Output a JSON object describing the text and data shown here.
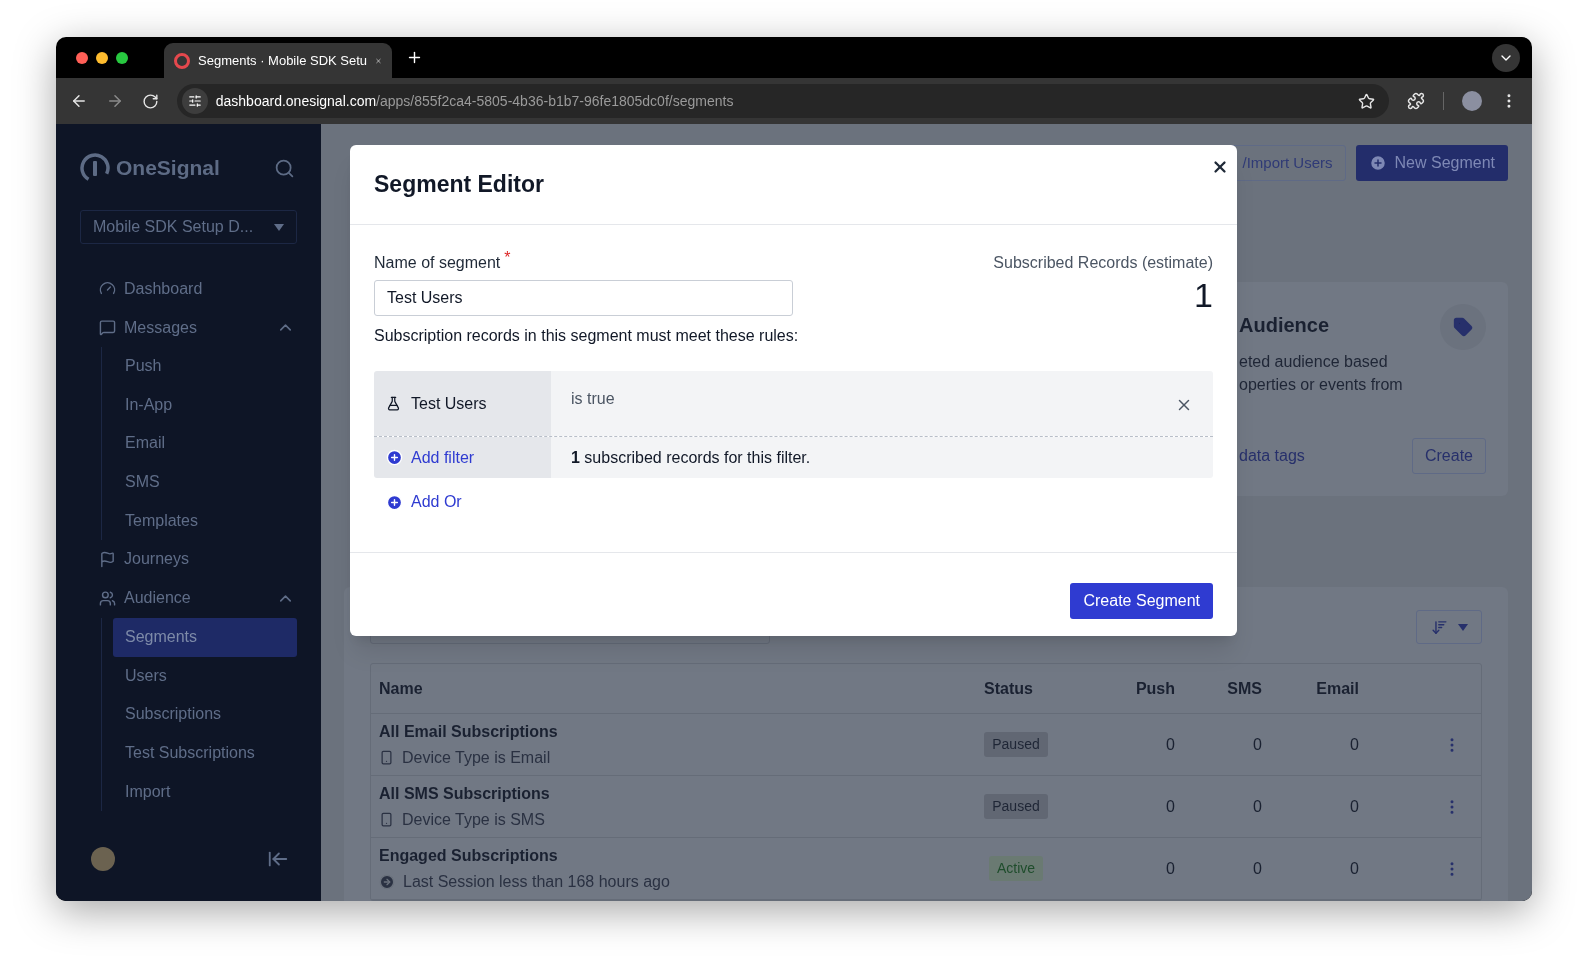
{
  "browser": {
    "tab": {
      "title": "Segments · Mobile SDK Setu"
    },
    "url": {
      "host": "dashboard.onesignal.com",
      "path": "/apps/855f2ca4-5805-4b36-b1b7-96fe1805dc0f/segments"
    }
  },
  "sidebar": {
    "brand": "OneSignal",
    "app_selector": "Mobile SDK Setup D...",
    "nav": [
      {
        "label": "Dashboard",
        "selected": false
      },
      {
        "label": "Messages",
        "selected": false,
        "expanded": true,
        "children": [
          {
            "label": "Push",
            "selected": false
          },
          {
            "label": "In-App",
            "selected": false
          },
          {
            "label": "Email",
            "selected": false
          },
          {
            "label": "SMS",
            "selected": false
          },
          {
            "label": "Templates",
            "selected": false
          }
        ]
      },
      {
        "label": "Journeys",
        "selected": false
      },
      {
        "label": "Audience",
        "selected": false,
        "expanded": true,
        "children": [
          {
            "label": "Segments",
            "selected": true
          },
          {
            "label": "Users",
            "selected": false
          },
          {
            "label": "Subscriptions",
            "selected": false
          },
          {
            "label": "Test Subscriptions",
            "selected": false
          },
          {
            "label": "Import",
            "selected": false
          }
        ]
      }
    ]
  },
  "header_buttons": [
    {
      "label": "/Import Users",
      "kind": "outline"
    },
    {
      "label": "New Segment",
      "kind": "primary"
    }
  ],
  "audience_card": {
    "title": "Audience",
    "lines": [
      "eted audience based",
      "operties or events from"
    ],
    "link": "data tags",
    "button": "Create"
  },
  "table": {
    "columns": [
      "Name",
      "Status",
      "Push",
      "SMS",
      "Email"
    ],
    "rows": [
      {
        "name": "All Email Subscriptions",
        "rule": {
          "text": "Device Type is Email",
          "kind": "device"
        },
        "status": {
          "label": "Paused",
          "kind": "paused"
        },
        "push": "0",
        "sms": "0",
        "email": "0"
      },
      {
        "name": "All SMS Subscriptions",
        "rule": {
          "text": "Device Type is SMS",
          "kind": "device"
        },
        "status": {
          "label": "Paused",
          "kind": "paused"
        },
        "push": "0",
        "sms": "0",
        "email": "0"
      },
      {
        "name": "Engaged Subscriptions",
        "rule": {
          "text": "Last Session less than 168 hours ago",
          "kind": "session"
        },
        "status": {
          "label": "Active",
          "kind": "active"
        },
        "push": "0",
        "sms": "0",
        "email": "0"
      }
    ]
  },
  "modal": {
    "title": "Segment Editor",
    "name_label": "Name of segment",
    "required_mark": "*",
    "name_value": "Test Users",
    "estimate_label": "Subscribed Records (estimate)",
    "estimate": "1",
    "rules_intro": "Subscription records in this segment must meet these rules:",
    "filters": [
      {
        "name": "Test Users",
        "condition": "is true"
      }
    ],
    "add_filter": "Add filter",
    "filter_count": "**1** subscribed records for this filter.",
    "add_or": "Add Or",
    "submit": "Create Segment"
  }
}
